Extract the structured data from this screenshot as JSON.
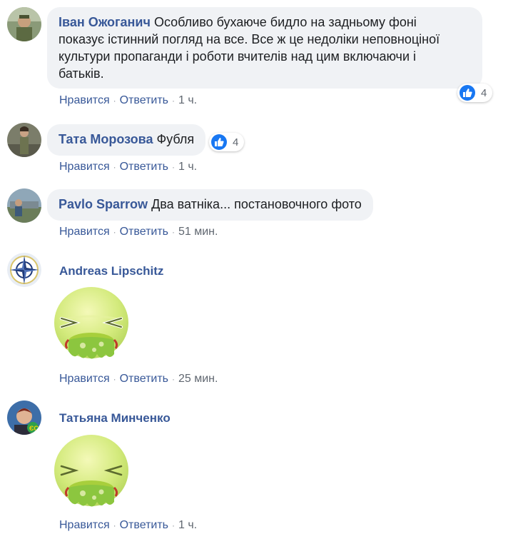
{
  "comments": [
    {
      "author": "Іван Ожоганич",
      "text": "Особливо бухаюче бидло на задньому фоні показує істинний погляд на все. Все ж це недоліки неповноціної культури пропаганди і роботи вчителів над цим включаючи і батьків.",
      "line1": "Особливо бухаюче бидло на задньому фоні",
      "line2": "показує істинний погляд на все. Все ж це недоліки неповноціної",
      "line3": "культури пропаганди і роботи вчителів над цим включаючи і",
      "line4": "батьків.",
      "reactions": "4",
      "like": "Нравится",
      "reply": "Ответить",
      "time": "1 ч."
    },
    {
      "author": "Тата Морозова",
      "text": "Фубля",
      "reactions": "4",
      "like": "Нравится",
      "reply": "Ответить",
      "time": "1 ч."
    },
    {
      "author": "Pavlo Sparrow",
      "text": "Два ватніка... постановочного фото",
      "like": "Нравится",
      "reply": "Ответить",
      "time": "51 мин."
    },
    {
      "author": "Andreas Lipschitz",
      "sticker": "vomit-sticker",
      "like": "Нравится",
      "reply": "Ответить",
      "time": "25 мин."
    },
    {
      "author": "Татьяна Минченко",
      "sticker": "vomit-sticker",
      "like": "Нравится",
      "reply": "Ответить",
      "time": "1 ч."
    }
  ],
  "separator": "·",
  "colors": {
    "link": "#385898",
    "bubble": "#f0f2f5",
    "meta": "#606770",
    "like_blue": "#1877f2",
    "sticker_green": "#b8e06a"
  },
  "icons": [
    "like-icon",
    "nato-compass-icon",
    "vomit-sticker"
  ]
}
